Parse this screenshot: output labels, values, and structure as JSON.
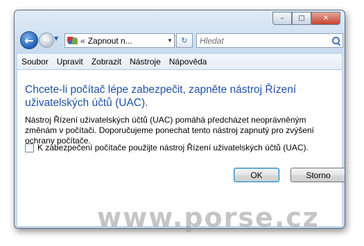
{
  "window": {
    "caption_buttons": {
      "minimize": "–",
      "maximize": "□",
      "close": "✕"
    }
  },
  "nav": {
    "back_glyph": "←",
    "forward_glyph": "→",
    "address_separator": "«",
    "address_text": "Zapnout n...",
    "refresh_glyph": "↻",
    "search_placeholder": "Hledat"
  },
  "menubar": {
    "items": [
      "Soubor",
      "Upravit",
      "Zobrazit",
      "Nástroje",
      "Nápověda"
    ]
  },
  "content": {
    "heading": "Chcete-li počítač lépe zabezpečit, zapněte nástroj Řízení uživatelských účtů (UAC).",
    "description": "Nástroj Řízení uživatelských účtů (UAC) pomáhá předcházet neoprávněným změnám v počítači. Doporučujeme ponechat tento nástroj zapnutý pro zvýšení ochrany počítače.",
    "checkbox_label": "K zabezpečení počítače použijte nástroj Řízení uživatelských účtů (UAC).",
    "checkbox_checked": false,
    "ok_label": "OK",
    "cancel_label": "Storno"
  },
  "watermark": "www.porse.cz",
  "colors": {
    "heading": "#1f4fa5",
    "accent": "#1d5fb3"
  }
}
